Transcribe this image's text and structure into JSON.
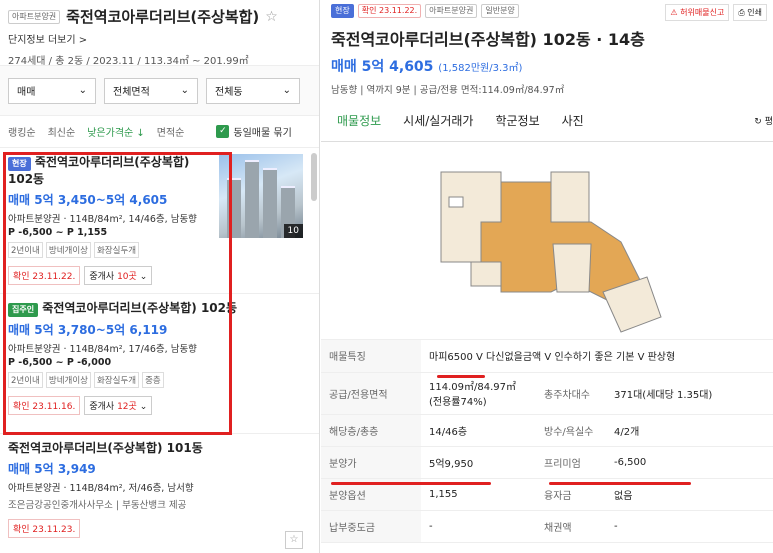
{
  "left": {
    "badge": "아파트분양권",
    "title": "죽전역코아루더리브(주상복합)",
    "complex_link": "단지정보 더보기 >",
    "summary": "274세대 / 총 2동 / 2023.11 / 113.34㎡ ~ 201.99㎡",
    "filters": [
      "매매",
      "전체면적",
      "전체동"
    ],
    "sorts": [
      "랭킹순",
      "최신순",
      "낮은가격순 ↓",
      "면적순"
    ],
    "same_listing_label": "동일매물 묶기",
    "cards": [
      {
        "badge": "현장",
        "title": "죽전역코아루더리브(주상복합) 102동",
        "price": "매매 5억 3,450~5억 4,605",
        "spec": "아파트분양권 · 114B/84m², 14/46층, 남동향",
        "premium": "P -6,500 ~ P 1,155",
        "features": [
          "2년이내",
          "방네개이상",
          "화장실두개"
        ],
        "date": "확인 23.11.22.",
        "agent_prefix": "중개사 ",
        "agent_count": "10곳",
        "photo_count": "10"
      },
      {
        "badge": "집주인",
        "title": "죽전역코아루더리브(주상복합) 102동",
        "price": "매매 5억 3,780~5억 6,119",
        "spec": "아파트분양권 · 114B/84m², 17/46층, 남동향",
        "premium": "P -6,500 ~ P -6,000",
        "features": [
          "2년이내",
          "방네개이상",
          "화장실두개",
          "중층"
        ],
        "date": "확인 23.11.16.",
        "agent_prefix": "중개사 ",
        "agent_count": "12곳"
      },
      {
        "title": "죽전역코아루더리브(주상복합) 101동",
        "price": "매매 5억 3,949",
        "spec": "아파트분양권 · 114B/84m², 저/46층, 남서향",
        "agency": "조은금강공인중개사사무소 | 부동산뱅크 제공",
        "date": "확인 23.11.23."
      }
    ]
  },
  "right": {
    "badges": [
      "현장",
      "확인 23.11.22.",
      "아파트분양권",
      "일반분양"
    ],
    "buttons": [
      "허위매물신고",
      "인쇄"
    ],
    "title": "죽전역코아루더리브(주상복합) 102동 · 14층",
    "price": "매매 5억 4,605",
    "price_unit": "(1,582만원/3.3㎡)",
    "info": "남동향  |  역까지 9분  |  공급/전용 면적:114.09㎡/84.97㎡",
    "tabs": [
      "매물정보",
      "시세/실거래가",
      "학군정보",
      "사진"
    ],
    "side_tab": "평",
    "rows": {
      "feature_label": "매물특징",
      "feature_value": "마피6500 V 다신없을금액 V 인수하기 좋은 기본 V 판상형",
      "area_label": "공급/전용면적",
      "area_value": "114.09㎡/84.97㎡(전용률74%)",
      "parking_label": "총주차대수",
      "parking_value": "371대(세대당 1.35대)",
      "floor_label": "해당층/총층",
      "floor_value": "14/46층",
      "rooms_label": "방수/욕실수",
      "rooms_value": "4/2개",
      "sale_label": "분양가",
      "sale_value": "5억9,950",
      "premium_label": "프리미엄",
      "premium_value": "-6,500",
      "option_label": "분양옵션",
      "option_value": "1,155",
      "loan_label": "융자금",
      "loan_value": "없음",
      "mid_label": "납부중도금",
      "mid_value": "-",
      "bond_label": "채권액",
      "bond_value": "-"
    }
  },
  "colors": {
    "accent_green": "#2e9a4d",
    "price_blue": "#2d6de0",
    "highlight_red": "#e02020"
  }
}
